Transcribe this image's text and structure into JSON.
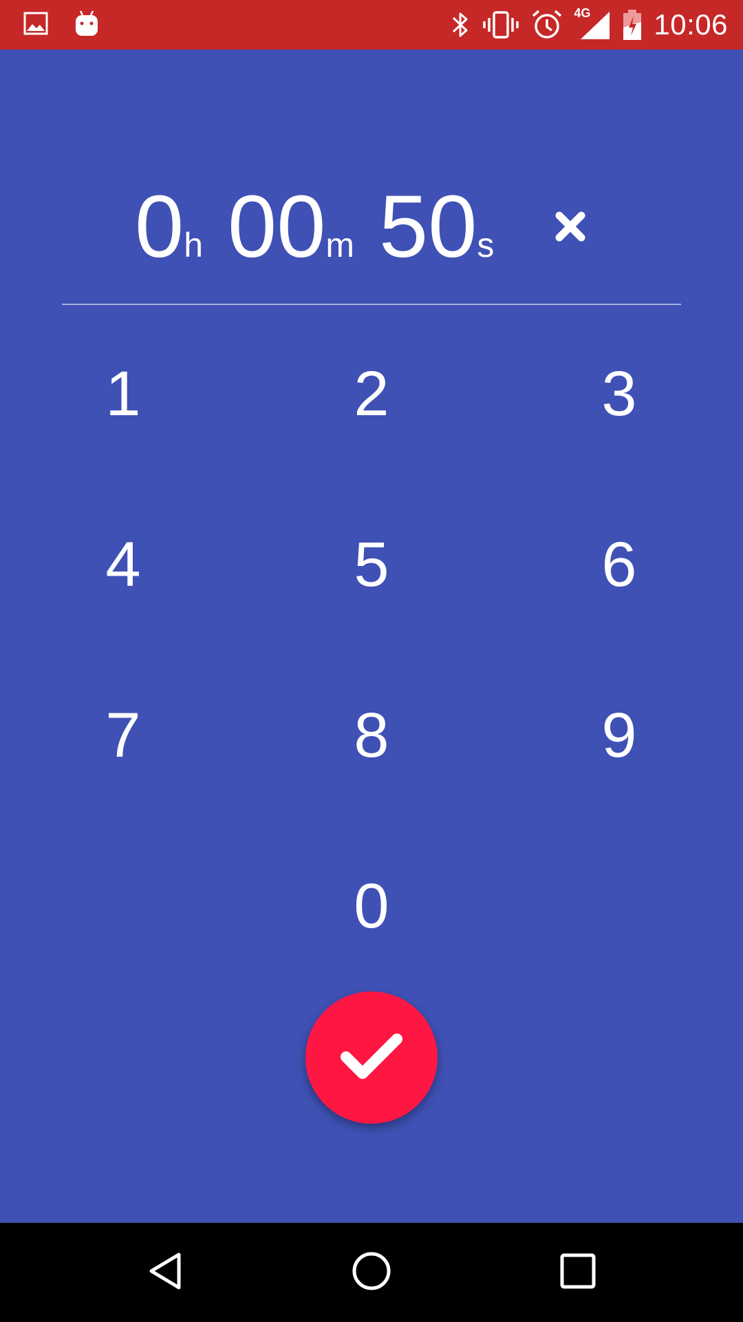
{
  "status_bar": {
    "time": "10:06",
    "network_label": "4G",
    "colors": {
      "background": "#C62828",
      "foreground": "#FFFFFF"
    },
    "icons_left": [
      "image-icon",
      "android-icon"
    ],
    "icons_right": [
      "bluetooth-icon",
      "vibrate-icon",
      "alarm-icon",
      "signal-icon",
      "battery-icon"
    ]
  },
  "timer": {
    "hours": "0",
    "hours_unit": "h",
    "minutes": "00",
    "minutes_unit": "m",
    "seconds": "50",
    "seconds_unit": "s",
    "clear_icon": "close-icon"
  },
  "keypad": {
    "keys": [
      "1",
      "2",
      "3",
      "4",
      "5",
      "6",
      "7",
      "8",
      "9",
      "0"
    ]
  },
  "fab": {
    "icon": "check-icon",
    "color": "#FF1744"
  },
  "nav_bar": {
    "icons": [
      "back-icon",
      "home-icon",
      "recents-icon"
    ]
  },
  "theme": {
    "background": "#3F51B5"
  }
}
